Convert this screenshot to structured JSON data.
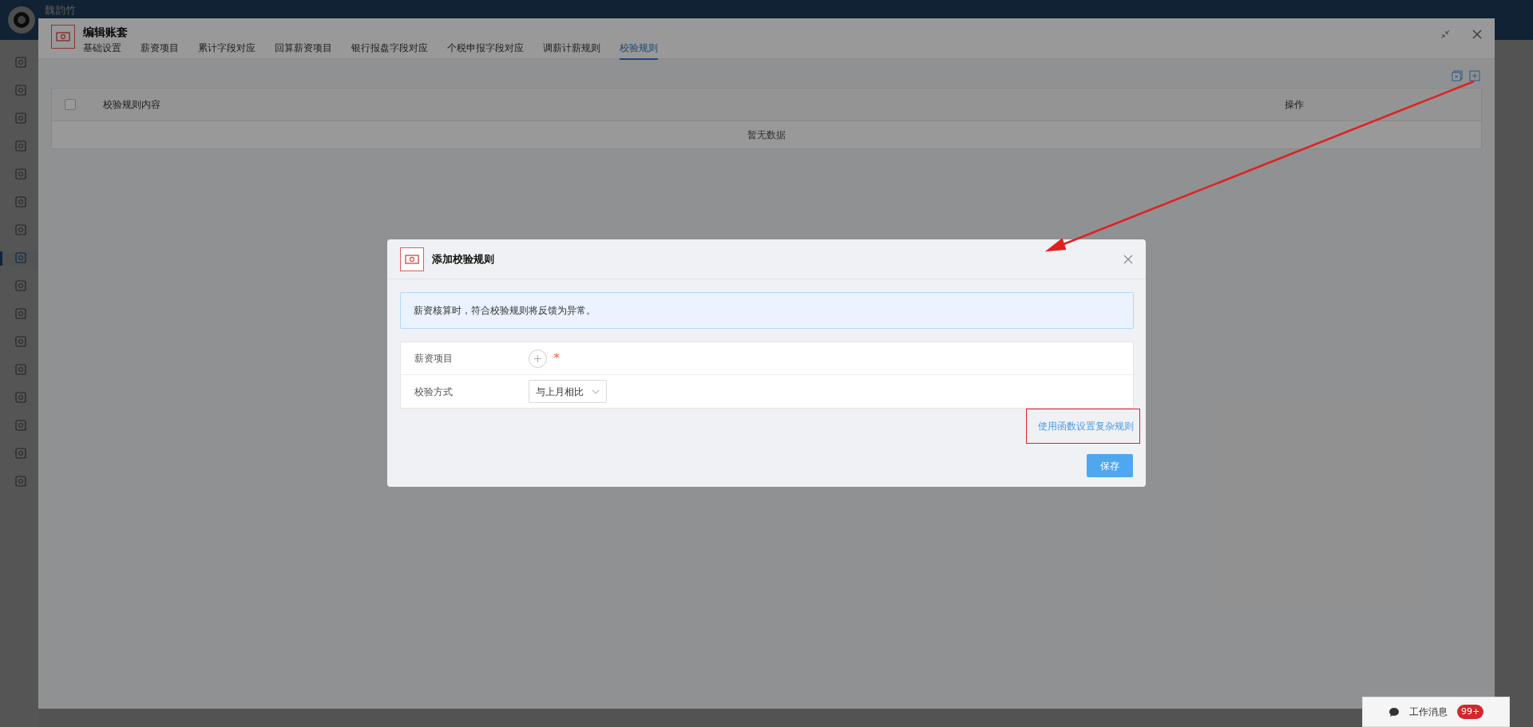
{
  "top_bar": {
    "user_name": "魏韵竹"
  },
  "sidebar": {
    "items": [
      {
        "selected": false
      },
      {
        "selected": false
      },
      {
        "selected": false
      },
      {
        "selected": false
      },
      {
        "selected": false
      },
      {
        "selected": false
      },
      {
        "selected": false
      },
      {
        "selected": true
      },
      {
        "selected": false
      },
      {
        "selected": false
      },
      {
        "selected": false
      },
      {
        "selected": false
      },
      {
        "selected": false
      },
      {
        "selected": false
      },
      {
        "selected": false
      },
      {
        "selected": false
      }
    ]
  },
  "edit_window": {
    "title": "编辑账套",
    "tabs": [
      {
        "label": "基础设置",
        "selected": false
      },
      {
        "label": "薪资项目",
        "selected": false
      },
      {
        "label": "累计字段对应",
        "selected": false
      },
      {
        "label": "回算薪资项目",
        "selected": false
      },
      {
        "label": "银行报盘字段对应",
        "selected": false
      },
      {
        "label": "个税申报字段对应",
        "selected": false
      },
      {
        "label": "调薪计薪规则",
        "selected": false
      },
      {
        "label": "校验规则",
        "selected": true
      }
    ],
    "table": {
      "select_all_checked": false,
      "columns": [
        "校验规则内容",
        "操作"
      ],
      "empty_text": "暂无数据"
    }
  },
  "dialog": {
    "title": "添加校验规则",
    "notice": "薪资核算时，符合校验规则将反馈为异常。",
    "fields": [
      {
        "label": "薪资项目",
        "kind": "add",
        "required_mark": "*"
      },
      {
        "label": "校验方式",
        "kind": "select",
        "value": "与上月相比"
      }
    ],
    "link": "使用函数设置复杂规则",
    "save_button": "保存"
  },
  "message_bar": {
    "label": "工作消息",
    "badge": "99+"
  }
}
